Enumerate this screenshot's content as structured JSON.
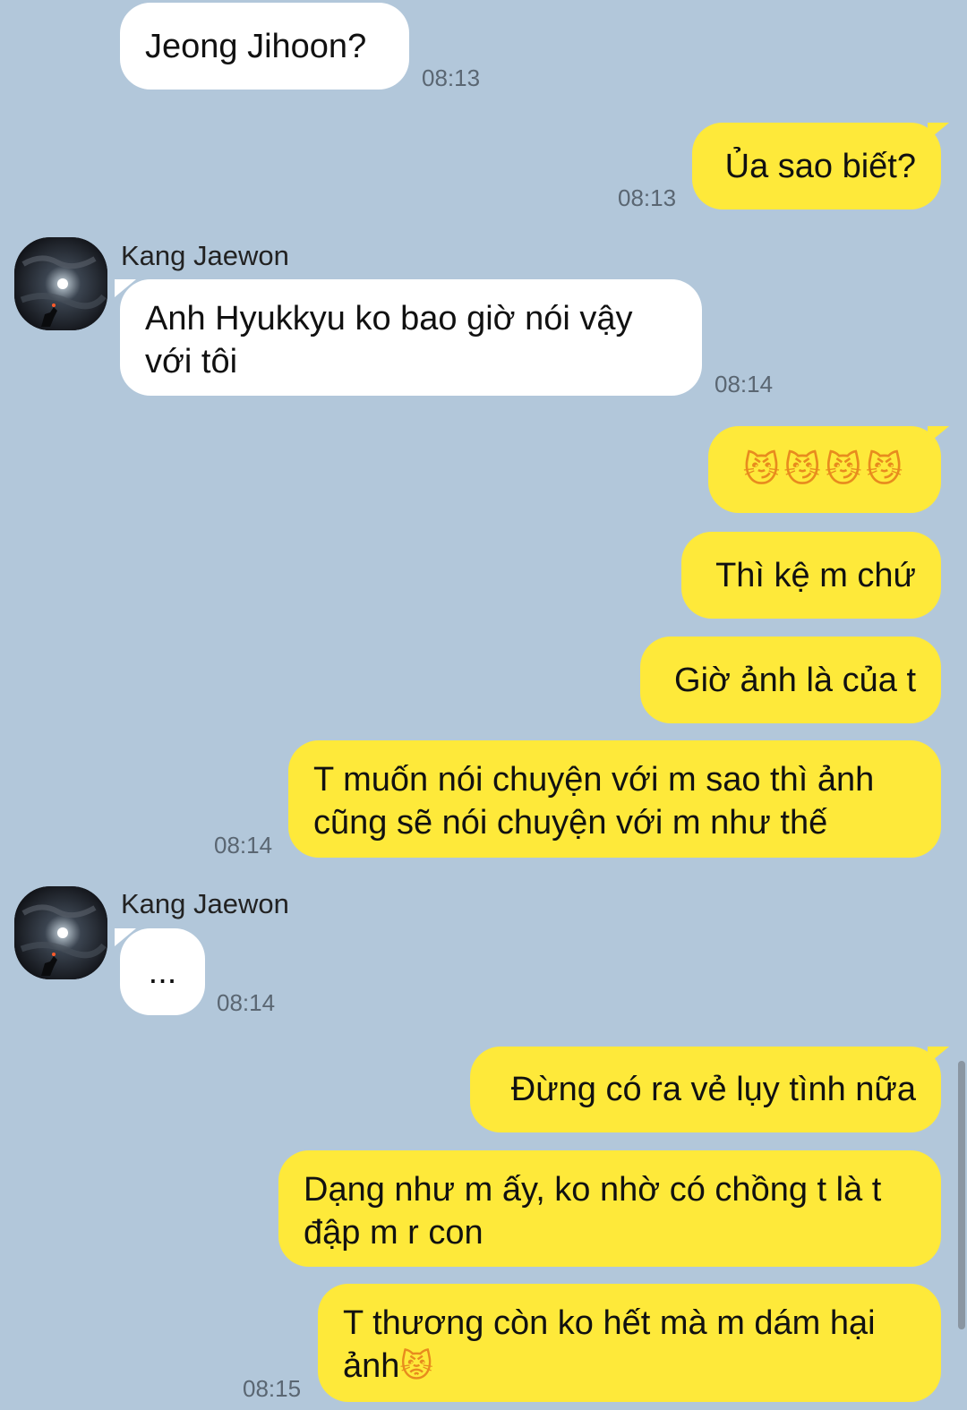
{
  "contact": {
    "name": "Kang Jaewon"
  },
  "messages": [
    {
      "text": "Jeong Jihoon?",
      "time": "08:13"
    },
    {
      "text": "Ủa sao biết?",
      "time": "08:13"
    },
    {
      "text": "Anh Hyukkyu ko bao giờ nói vậy với tôi",
      "line1": "Anh Hyukkyu ko bao giờ nói vậy",
      "line2": "với tôi",
      "time": "08:14"
    },
    {
      "emojis": [
        "😼",
        "😼",
        "😼",
        "😼"
      ],
      "emoji_icon": "smirking-cat-icon"
    },
    {
      "text": "Thì kệ m chứ"
    },
    {
      "text": "Giờ ảnh là của t"
    },
    {
      "text": "T muốn nói chuyện với m sao thì ảnh cũng sẽ nói chuyện với m như thế",
      "line1": "T muốn nói chuyện với m sao thì ảnh",
      "line2": "cũng sẽ nói chuyện với m như thế",
      "time": "08:14"
    },
    {
      "text": "...",
      "time": "08:14"
    },
    {
      "text": "Đừng có ra vẻ lụy tình nữa"
    },
    {
      "text": "Dạng như m ấy, ko nhờ có chồng t là t đập m r con",
      "line1": "Dạng như m ấy, ko nhờ có chồng t là t",
      "line2": "đập m r con"
    },
    {
      "text": "T thương còn ko hết mà m dám hại ảnh😾",
      "line1": "T thương còn ko hết mà m dám hại",
      "line2": "ảnh",
      "emoji": "😾",
      "emoji_icon": "pouting-cat-icon",
      "time": "08:15"
    }
  ],
  "colors": {
    "background": "#b2c7da",
    "incoming_bubble": "#ffffff",
    "outgoing_bubble": "#fee93a",
    "timestamp": "#5a6672"
  }
}
